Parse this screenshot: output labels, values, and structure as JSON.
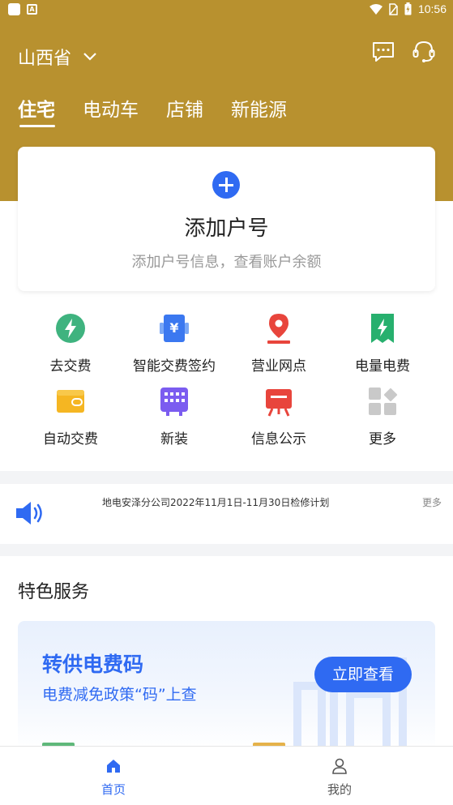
{
  "status_bar": {
    "time": "10:56"
  },
  "header": {
    "region": "山西省",
    "tabs": [
      {
        "label": "住宅",
        "active": true
      },
      {
        "label": "电动车",
        "active": false
      },
      {
        "label": "店铺",
        "active": false
      },
      {
        "label": "新能源",
        "active": false
      }
    ]
  },
  "add_account": {
    "title": "添加户号",
    "subtitle": "添加户号信息，查看账户余额"
  },
  "services": [
    {
      "label": "去交费",
      "icon": "lightning-icon"
    },
    {
      "label": "智能交费签约",
      "icon": "yuan-icon"
    },
    {
      "label": "营业网点",
      "icon": "location-icon"
    },
    {
      "label": "电量电费",
      "icon": "bill-icon"
    },
    {
      "label": "自动交费",
      "icon": "wallet-icon"
    },
    {
      "label": "新装",
      "icon": "meter-icon"
    },
    {
      "label": "信息公示",
      "icon": "board-icon"
    },
    {
      "label": "更多",
      "icon": "more-icon"
    }
  ],
  "notice": {
    "text": "地电安泽分公司2022年11月1日-11月30日检修计划",
    "more": "更多"
  },
  "featured": {
    "title": "特色服务",
    "promo_title": "转供电费码",
    "promo_subtitle": "电费减免政策“码”上查",
    "promo_button": "立即查看"
  },
  "bottom_nav": {
    "home": "首页",
    "mine": "我的"
  },
  "colors": {
    "header_gold": "#b8912f",
    "accent_blue": "#2f6af2"
  }
}
